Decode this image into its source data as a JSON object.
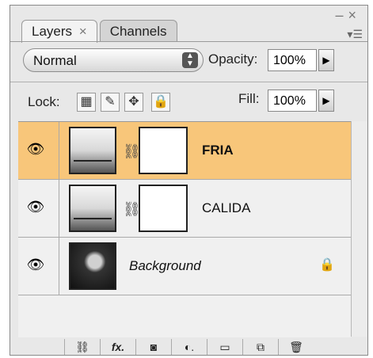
{
  "tabs": [
    {
      "label": "Layers",
      "close": "×",
      "active": true
    },
    {
      "label": "Channels",
      "active": false
    }
  ],
  "window_controls": {
    "minimize": "–",
    "close": "×"
  },
  "panel_menu_icon": "panel-menu-icon",
  "blend": {
    "mode": "Normal"
  },
  "opacity": {
    "label": "Opacity:",
    "value": "100%"
  },
  "lock": {
    "label": "Lock:"
  },
  "fill": {
    "label": "Fill:",
    "value": "100%"
  },
  "layers": [
    {
      "name": "FRIA",
      "selected": true,
      "type": "curves-adjustment"
    },
    {
      "name": "CALIDA",
      "selected": false,
      "type": "curves-adjustment"
    },
    {
      "name": "Background",
      "selected": false,
      "type": "image",
      "locked": true
    }
  ],
  "bottom_icons": [
    "link-layers-icon",
    "fx-icon",
    "layer-mask-icon",
    "adjustment-layer-icon",
    "group-folder-icon",
    "new-layer-icon",
    "trash-icon"
  ],
  "colors": {
    "selected_row": "#f8c67a",
    "panel_bg": "#e8e8e8"
  }
}
